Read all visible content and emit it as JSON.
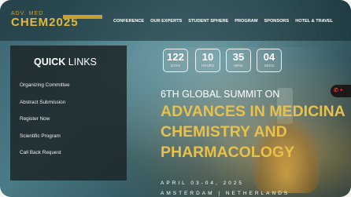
{
  "logo": {
    "top": "ADV. MED",
    "main": "CHEM2025"
  },
  "nav": [
    "CONFERENCE",
    "OUR EXPERTS",
    "STUDENT SPHERE",
    "PROGRAM",
    "SPONSORS",
    "HOTEL & TRAVEL"
  ],
  "quick_links": {
    "title_bold": "QUICK",
    "title_rest": "LINKS",
    "items": [
      "Organizing Committee",
      "Abstract Submission",
      "Register Now",
      "Scientific Program",
      "Call Back Request"
    ]
  },
  "countdown": [
    {
      "value": "122",
      "label": "DAYS"
    },
    {
      "value": "10",
      "label": "HOURS"
    },
    {
      "value": "35",
      "label": "MINS"
    },
    {
      "value": "04",
      "label": "SECO"
    }
  ],
  "hero": {
    "summit": "6TH GLOBAL SUMMIT ON",
    "lines": [
      "ADVANCES IN MEDICINA",
      "CHEMISTRY AND",
      "PHARMACOLOGY"
    ],
    "date": "APRIL 03-04, 2025",
    "venue": "AMSTERDAM | NETHERLANDS"
  },
  "whatsapp": {
    "label": "✆ +"
  },
  "colors": {
    "accent": "#e8c14a",
    "panel": "#1c282a"
  }
}
